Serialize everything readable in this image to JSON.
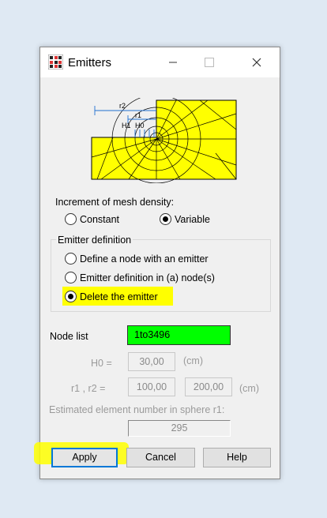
{
  "window": {
    "title": "Emitters",
    "minimize_icon": "minimize-icon",
    "maximize_icon": "maximize-icon",
    "close_icon": "close-icon"
  },
  "diagram": {
    "labels": {
      "r2": "r2",
      "r1": "r1",
      "H1": "H1",
      "H0": "H0"
    },
    "fill_color": "#ffff00"
  },
  "increment": {
    "label": "Increment of mesh density:",
    "options": [
      {
        "label": "Constant",
        "selected": false
      },
      {
        "label": "Variable",
        "selected": true
      }
    ]
  },
  "emitter_definition": {
    "legend": "Emitter definition",
    "options": [
      {
        "label": "Define a node with an emitter",
        "selected": false
      },
      {
        "label": "Emitter definition in (a) node(s)",
        "selected": false
      },
      {
        "label": "Delete the emitter",
        "selected": true
      }
    ],
    "highlight_color": "#ffff00"
  },
  "node_list": {
    "label": "Node list",
    "value": "1to3496",
    "highlight_color": "#00ff00"
  },
  "h0": {
    "label": "H0 =",
    "value": "30,00",
    "unit": "(cm)"
  },
  "r1r2": {
    "label": "r1 , r2 =",
    "r1": "100,00",
    "r2": "200,00",
    "unit": "(cm)"
  },
  "estimated": {
    "label": "Estimated element number in sphere r1:",
    "value": "295"
  },
  "buttons": {
    "apply": "Apply",
    "cancel": "Cancel",
    "help": "Help"
  }
}
